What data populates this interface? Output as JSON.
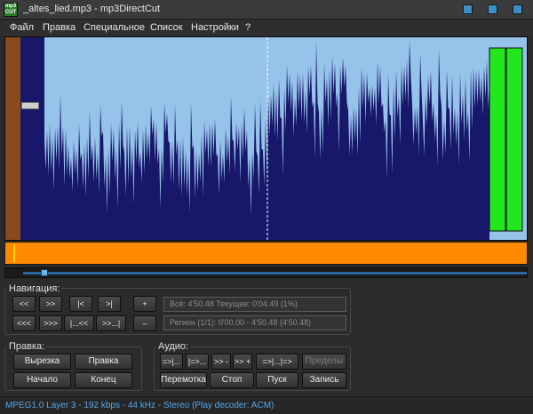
{
  "window": {
    "title": "_altes_lied.mp3 - mp3DirectCut",
    "icon_text": "mp3 CUT"
  },
  "menu": [
    "Файл",
    "Правка",
    "Специальное",
    "Список",
    "Настройки",
    "?"
  ],
  "colors": {
    "waveform_bg": "#96c3ea",
    "waveform_fg": "#18186b",
    "left_band": "#8a4b1c",
    "overview": "#ff8a00",
    "level_meter": "#22e61e",
    "status_text": "#57a8e8"
  },
  "navigation": {
    "label": "Навигация:",
    "buttons_row1": [
      "<<",
      ">>",
      "|<",
      ">|",
      "+"
    ],
    "buttons_row2": [
      "<<<",
      ">>>",
      "|...<<",
      ">>...|",
      "–"
    ],
    "info_total": "Всё: 4'50.48   Текущее: 0'04.49  (1%)",
    "info_region": "Регион (1/1): 0'00.00 - 4'50.48 (4'50.48)"
  },
  "edit": {
    "label": "Правка:",
    "buttons": [
      "Вырезка",
      "Правка",
      "Начало",
      "Конец"
    ]
  },
  "audio": {
    "label": "Аудио:",
    "buttons_row1": [
      "=>|...",
      "|=>...",
      ">> -",
      ">> +",
      "=>|...|=>",
      "Пределы"
    ],
    "buttons_row2": [
      "Перемотка",
      "Стоп",
      "Пуск",
      "Запись"
    ]
  },
  "status": "MPEG1.0 Layer 3 - 192 kbps - 44 kHz - Stereo   (Play decoder: ACM)"
}
